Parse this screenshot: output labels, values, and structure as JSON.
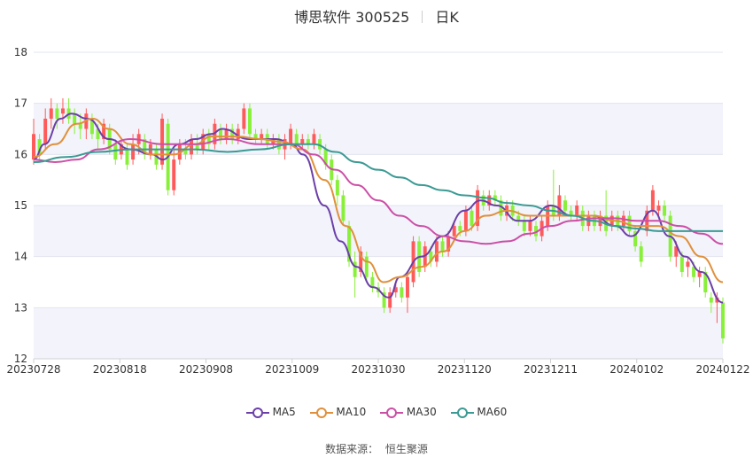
{
  "title": {
    "name": "博思软件 300525",
    "period": "日K"
  },
  "source": {
    "label": "数据来源：",
    "value": "恒生聚源"
  },
  "colors": {
    "up": "#ff5a5a",
    "down": "#89f03a",
    "ma5": "#6b3fa8",
    "ma10": "#e0903c",
    "ma30": "#cc4fa6",
    "ma60": "#3b9a93",
    "band": "#f2f3fb"
  },
  "chart_data": {
    "type": "candlestick",
    "ylim": [
      12,
      18
    ],
    "yticks": [
      "12",
      "13",
      "14",
      "15",
      "16",
      "17",
      "18"
    ],
    "xticks": [
      "20230728",
      "20230818",
      "20230908",
      "20231009",
      "20231030",
      "20231120",
      "20231211",
      "20240102",
      "20240122"
    ],
    "n_days": 120,
    "candles": [
      {
        "o": 15.9,
        "c": 16.4,
        "h": 16.7,
        "l": 15.8
      },
      {
        "o": 16.3,
        "c": 16.0,
        "h": 16.4,
        "l": 15.9
      },
      {
        "o": 16.2,
        "c": 16.7,
        "h": 16.9,
        "l": 16.1
      },
      {
        "o": 16.7,
        "c": 16.9,
        "h": 17.1,
        "l": 16.5
      },
      {
        "o": 16.9,
        "c": 16.7,
        "h": 17.0,
        "l": 16.5
      },
      {
        "o": 16.8,
        "c": 16.9,
        "h": 17.1,
        "l": 16.6
      },
      {
        "o": 16.9,
        "c": 16.7,
        "h": 17.1,
        "l": 16.6
      },
      {
        "o": 16.8,
        "c": 16.6,
        "h": 16.9,
        "l": 16.4
      },
      {
        "o": 16.6,
        "c": 16.5,
        "h": 16.8,
        "l": 16.3
      },
      {
        "o": 16.5,
        "c": 16.8,
        "h": 16.9,
        "l": 16.3
      },
      {
        "o": 16.7,
        "c": 16.4,
        "h": 16.8,
        "l": 16.3
      },
      {
        "o": 16.5,
        "c": 16.3,
        "h": 16.6,
        "l": 16.1
      },
      {
        "o": 16.3,
        "c": 16.6,
        "h": 16.7,
        "l": 16.2
      },
      {
        "o": 16.5,
        "c": 16.1,
        "h": 16.6,
        "l": 16.0
      },
      {
        "o": 16.2,
        "c": 15.9,
        "h": 16.3,
        "l": 15.8
      },
      {
        "o": 16.0,
        "c": 16.2,
        "h": 16.3,
        "l": 15.9
      },
      {
        "o": 16.1,
        "c": 15.8,
        "h": 16.2,
        "l": 15.7
      },
      {
        "o": 15.9,
        "c": 16.2,
        "h": 16.4,
        "l": 15.8
      },
      {
        "o": 16.2,
        "c": 16.4,
        "h": 16.5,
        "l": 16.0
      },
      {
        "o": 16.3,
        "c": 16.0,
        "h": 16.4,
        "l": 15.9
      },
      {
        "o": 16.0,
        "c": 16.2,
        "h": 16.3,
        "l": 15.9
      },
      {
        "o": 16.1,
        "c": 15.8,
        "h": 16.2,
        "l": 15.7
      },
      {
        "o": 15.8,
        "c": 16.7,
        "h": 16.8,
        "l": 15.7
      },
      {
        "o": 16.6,
        "c": 15.3,
        "h": 16.7,
        "l": 15.2
      },
      {
        "o": 15.3,
        "c": 15.9,
        "h": 16.1,
        "l": 15.2
      },
      {
        "o": 15.9,
        "c": 16.2,
        "h": 16.3,
        "l": 15.8
      },
      {
        "o": 16.1,
        "c": 16.0,
        "h": 16.3,
        "l": 15.9
      },
      {
        "o": 16.0,
        "c": 16.3,
        "h": 16.4,
        "l": 15.9
      },
      {
        "o": 16.2,
        "c": 16.1,
        "h": 16.4,
        "l": 16.0
      },
      {
        "o": 16.1,
        "c": 16.4,
        "h": 16.5,
        "l": 16.0
      },
      {
        "o": 16.4,
        "c": 16.2,
        "h": 16.5,
        "l": 16.1
      },
      {
        "o": 16.2,
        "c": 16.6,
        "h": 16.7,
        "l": 16.1
      },
      {
        "o": 16.5,
        "c": 16.3,
        "h": 16.6,
        "l": 16.2
      },
      {
        "o": 16.3,
        "c": 16.5,
        "h": 16.6,
        "l": 16.2
      },
      {
        "o": 16.5,
        "c": 16.3,
        "h": 16.6,
        "l": 16.2
      },
      {
        "o": 16.3,
        "c": 16.5,
        "h": 16.6,
        "l": 16.2
      },
      {
        "o": 16.5,
        "c": 16.9,
        "h": 17.0,
        "l": 16.4
      },
      {
        "o": 16.9,
        "c": 16.4,
        "h": 17.0,
        "l": 16.3
      },
      {
        "o": 16.4,
        "c": 16.3,
        "h": 16.5,
        "l": 16.2
      },
      {
        "o": 16.3,
        "c": 16.4,
        "h": 16.5,
        "l": 16.2
      },
      {
        "o": 16.4,
        "c": 16.2,
        "h": 16.5,
        "l": 16.1
      },
      {
        "o": 16.2,
        "c": 16.3,
        "h": 16.4,
        "l": 16.1
      },
      {
        "o": 16.3,
        "c": 16.1,
        "h": 16.4,
        "l": 16.0
      },
      {
        "o": 16.1,
        "c": 16.3,
        "h": 16.4,
        "l": 15.9
      },
      {
        "o": 16.2,
        "c": 16.5,
        "h": 16.6,
        "l": 16.1
      },
      {
        "o": 16.4,
        "c": 16.2,
        "h": 16.5,
        "l": 16.1
      },
      {
        "o": 16.2,
        "c": 16.3,
        "h": 16.4,
        "l": 16.1
      },
      {
        "o": 16.3,
        "c": 16.2,
        "h": 16.4,
        "l": 16.1
      },
      {
        "o": 16.2,
        "c": 16.4,
        "h": 16.5,
        "l": 16.1
      },
      {
        "o": 16.3,
        "c": 16.1,
        "h": 16.4,
        "l": 16.0
      },
      {
        "o": 16.1,
        "c": 15.8,
        "h": 16.2,
        "l": 15.7
      },
      {
        "o": 15.9,
        "c": 15.5,
        "h": 16.0,
        "l": 15.4
      },
      {
        "o": 15.5,
        "c": 15.2,
        "h": 15.6,
        "l": 15.0
      },
      {
        "o": 15.2,
        "c": 14.7,
        "h": 15.3,
        "l": 14.6
      },
      {
        "o": 14.6,
        "c": 13.9,
        "h": 14.7,
        "l": 13.8
      },
      {
        "o": 13.9,
        "c": 13.6,
        "h": 14.1,
        "l": 13.2
      },
      {
        "o": 13.7,
        "c": 14.1,
        "h": 14.2,
        "l": 13.6
      },
      {
        "o": 14.0,
        "c": 13.6,
        "h": 14.1,
        "l": 13.5
      },
      {
        "o": 13.6,
        "c": 13.4,
        "h": 13.7,
        "l": 13.3
      },
      {
        "o": 13.4,
        "c": 13.3,
        "h": 13.5,
        "l": 13.2
      },
      {
        "o": 13.3,
        "c": 13.0,
        "h": 13.4,
        "l": 12.9
      },
      {
        "o": 13.0,
        "c": 13.3,
        "h": 13.4,
        "l": 12.9
      },
      {
        "o": 13.3,
        "c": 13.4,
        "h": 13.5,
        "l": 13.2
      },
      {
        "o": 13.4,
        "c": 13.2,
        "h": 13.5,
        "l": 13.1
      },
      {
        "o": 13.2,
        "c": 13.6,
        "h": 13.7,
        "l": 12.9
      },
      {
        "o": 13.5,
        "c": 14.3,
        "h": 14.4,
        "l": 13.4
      },
      {
        "o": 14.3,
        "c": 13.7,
        "h": 14.4,
        "l": 13.6
      },
      {
        "o": 13.8,
        "c": 14.2,
        "h": 14.3,
        "l": 13.7
      },
      {
        "o": 14.1,
        "c": 13.9,
        "h": 14.2,
        "l": 13.8
      },
      {
        "o": 13.9,
        "c": 14.3,
        "h": 14.4,
        "l": 13.8
      },
      {
        "o": 14.3,
        "c": 14.1,
        "h": 14.4,
        "l": 14.0
      },
      {
        "o": 14.1,
        "c": 14.4,
        "h": 14.5,
        "l": 14.0
      },
      {
        "o": 14.4,
        "c": 14.6,
        "h": 14.7,
        "l": 14.3
      },
      {
        "o": 14.6,
        "c": 14.5,
        "h": 14.7,
        "l": 14.4
      },
      {
        "o": 14.5,
        "c": 14.9,
        "h": 15.0,
        "l": 14.4
      },
      {
        "o": 14.9,
        "c": 14.6,
        "h": 15.0,
        "l": 14.5
      },
      {
        "o": 14.6,
        "c": 15.3,
        "h": 15.4,
        "l": 14.5
      },
      {
        "o": 15.2,
        "c": 15.0,
        "h": 15.3,
        "l": 14.9
      },
      {
        "o": 15.0,
        "c": 15.2,
        "h": 15.3,
        "l": 14.9
      },
      {
        "o": 15.2,
        "c": 15.1,
        "h": 15.3,
        "l": 15.0
      },
      {
        "o": 15.1,
        "c": 14.8,
        "h": 15.2,
        "l": 14.7
      },
      {
        "o": 14.8,
        "c": 15.0,
        "h": 15.1,
        "l": 14.7
      },
      {
        "o": 15.0,
        "c": 14.8,
        "h": 15.1,
        "l": 14.7
      },
      {
        "o": 14.8,
        "c": 14.7,
        "h": 14.9,
        "l": 14.6
      },
      {
        "o": 14.7,
        "c": 14.5,
        "h": 14.8,
        "l": 14.4
      },
      {
        "o": 14.5,
        "c": 14.7,
        "h": 14.8,
        "l": 14.4
      },
      {
        "o": 14.6,
        "c": 14.4,
        "h": 14.7,
        "l": 14.3
      },
      {
        "o": 14.4,
        "c": 14.7,
        "h": 14.8,
        "l": 14.3
      },
      {
        "o": 14.6,
        "c": 15.0,
        "h": 15.1,
        "l": 14.5
      },
      {
        "o": 15.0,
        "c": 14.8,
        "h": 15.7,
        "l": 14.7
      },
      {
        "o": 14.8,
        "c": 15.2,
        "h": 15.4,
        "l": 14.7
      },
      {
        "o": 15.1,
        "c": 14.9,
        "h": 15.2,
        "l": 14.8
      },
      {
        "o": 14.9,
        "c": 14.8,
        "h": 15.0,
        "l": 14.7
      },
      {
        "o": 14.8,
        "c": 15.0,
        "h": 15.1,
        "l": 14.7
      },
      {
        "o": 14.9,
        "c": 14.6,
        "h": 15.0,
        "l": 14.5
      },
      {
        "o": 14.6,
        "c": 14.8,
        "h": 14.9,
        "l": 14.5
      },
      {
        "o": 14.8,
        "c": 14.6,
        "h": 14.9,
        "l": 14.5
      },
      {
        "o": 14.6,
        "c": 14.8,
        "h": 14.9,
        "l": 14.5
      },
      {
        "o": 14.8,
        "c": 14.5,
        "h": 15.3,
        "l": 14.4
      },
      {
        "o": 14.6,
        "c": 14.8,
        "h": 14.9,
        "l": 14.5
      },
      {
        "o": 14.8,
        "c": 14.6,
        "h": 14.9,
        "l": 14.5
      },
      {
        "o": 14.6,
        "c": 14.8,
        "h": 14.9,
        "l": 14.5
      },
      {
        "o": 14.8,
        "c": 14.5,
        "h": 14.9,
        "l": 14.4
      },
      {
        "o": 14.5,
        "c": 14.2,
        "h": 14.6,
        "l": 14.1
      },
      {
        "o": 14.2,
        "c": 13.9,
        "h": 14.3,
        "l": 13.8
      },
      {
        "o": 14.5,
        "c": 14.9,
        "h": 15.0,
        "l": 14.4
      },
      {
        "o": 14.9,
        "c": 15.3,
        "h": 15.4,
        "l": 14.8
      },
      {
        "o": 14.9,
        "c": 15.0,
        "h": 15.1,
        "l": 14.8
      },
      {
        "o": 15.0,
        "c": 14.8,
        "h": 15.1,
        "l": 14.7
      },
      {
        "o": 14.8,
        "c": 14.0,
        "h": 14.9,
        "l": 13.9
      },
      {
        "o": 14.0,
        "c": 14.2,
        "h": 14.3,
        "l": 13.8
      },
      {
        "o": 14.0,
        "c": 13.7,
        "h": 14.1,
        "l": 13.6
      },
      {
        "o": 13.8,
        "c": 13.9,
        "h": 14.0,
        "l": 13.6
      },
      {
        "o": 13.8,
        "c": 13.6,
        "h": 13.9,
        "l": 13.5
      },
      {
        "o": 13.6,
        "c": 13.7,
        "h": 13.8,
        "l": 13.4
      },
      {
        "o": 13.7,
        "c": 13.3,
        "h": 13.8,
        "l": 13.2
      },
      {
        "o": 13.2,
        "c": 13.1,
        "h": 13.3,
        "l": 12.9
      },
      {
        "o": 13.1,
        "c": 13.2,
        "h": 13.3,
        "l": 12.7
      },
      {
        "o": 13.1,
        "c": 12.4,
        "h": 13.2,
        "l": 12.3
      }
    ],
    "series": [
      {
        "name": "MA5",
        "points": [
          [
            0,
            15.9
          ],
          [
            2,
            16.2
          ],
          [
            5,
            16.7
          ],
          [
            7,
            16.8
          ],
          [
            10,
            16.7
          ],
          [
            14,
            16.3
          ],
          [
            18,
            16.1
          ],
          [
            22,
            16.0
          ],
          [
            24,
            15.9
          ],
          [
            27,
            16.2
          ],
          [
            30,
            16.3
          ],
          [
            33,
            16.4
          ],
          [
            35,
            16.5
          ],
          [
            40,
            16.3
          ],
          [
            45,
            16.3
          ],
          [
            48,
            16.2
          ],
          [
            50,
            16.0
          ],
          [
            54,
            15.0
          ],
          [
            57,
            14.3
          ],
          [
            60,
            13.8
          ],
          [
            63,
            13.4
          ],
          [
            66,
            13.2
          ],
          [
            68,
            13.6
          ],
          [
            72,
            14.0
          ],
          [
            76,
            14.4
          ],
          [
            80,
            14.9
          ],
          [
            83,
            15.1
          ],
          [
            86,
            15.0
          ],
          [
            90,
            14.7
          ],
          [
            92,
            14.7
          ],
          [
            96,
            15.0
          ],
          [
            100,
            14.8
          ],
          [
            104,
            14.8
          ],
          [
            108,
            14.6
          ],
          [
            111,
            14.4
          ],
          [
            115,
            14.9
          ],
          [
            118,
            14.4
          ],
          [
            121,
            14.0
          ],
          [
            124,
            13.7
          ],
          [
            128,
            13.1
          ]
        ]
      },
      {
        "name": "MA10",
        "points": [
          [
            0,
            15.95
          ],
          [
            4,
            16.2
          ],
          [
            8,
            16.6
          ],
          [
            11,
            16.7
          ],
          [
            14,
            16.5
          ],
          [
            18,
            16.2
          ],
          [
            22,
            16.0
          ],
          [
            26,
            16.0
          ],
          [
            30,
            16.2
          ],
          [
            33,
            16.35
          ],
          [
            38,
            16.35
          ],
          [
            42,
            16.3
          ],
          [
            46,
            16.25
          ],
          [
            50,
            16.1
          ],
          [
            54,
            15.5
          ],
          [
            58,
            14.6
          ],
          [
            62,
            13.9
          ],
          [
            65,
            13.5
          ],
          [
            68,
            13.6
          ],
          [
            72,
            13.8
          ],
          [
            76,
            14.1
          ],
          [
            80,
            14.5
          ],
          [
            84,
            14.8
          ],
          [
            88,
            14.9
          ],
          [
            92,
            14.8
          ],
          [
            96,
            14.8
          ],
          [
            100,
            14.8
          ],
          [
            104,
            14.8
          ],
          [
            108,
            14.7
          ],
          [
            112,
            14.6
          ],
          [
            116,
            14.6
          ],
          [
            120,
            14.4
          ],
          [
            124,
            14.0
          ],
          [
            128,
            13.5
          ]
        ]
      },
      {
        "name": "MA30",
        "points": [
          [
            0,
            15.9
          ],
          [
            4,
            15.85
          ],
          [
            8,
            15.9
          ],
          [
            12,
            16.1
          ],
          [
            18,
            16.3
          ],
          [
            24,
            16.2
          ],
          [
            30,
            16.2
          ],
          [
            36,
            16.3
          ],
          [
            42,
            16.2
          ],
          [
            48,
            16.2
          ],
          [
            52,
            16.0
          ],
          [
            56,
            15.7
          ],
          [
            60,
            15.4
          ],
          [
            64,
            15.1
          ],
          [
            68,
            14.8
          ],
          [
            72,
            14.6
          ],
          [
            76,
            14.4
          ],
          [
            80,
            14.3
          ],
          [
            84,
            14.25
          ],
          [
            88,
            14.3
          ],
          [
            92,
            14.45
          ],
          [
            96,
            14.6
          ],
          [
            100,
            14.7
          ],
          [
            104,
            14.75
          ],
          [
            108,
            14.75
          ],
          [
            112,
            14.7
          ],
          [
            116,
            14.7
          ],
          [
            120,
            14.6
          ],
          [
            124,
            14.45
          ],
          [
            128,
            14.25
          ]
        ]
      },
      {
        "name": "MA60",
        "points": [
          [
            0,
            15.85
          ],
          [
            6,
            15.95
          ],
          [
            12,
            16.05
          ],
          [
            18,
            16.1
          ],
          [
            24,
            16.1
          ],
          [
            30,
            16.1
          ],
          [
            36,
            16.05
          ],
          [
            42,
            16.1
          ],
          [
            48,
            16.2
          ],
          [
            52,
            16.2
          ],
          [
            56,
            16.05
          ],
          [
            60,
            15.85
          ],
          [
            64,
            15.7
          ],
          [
            68,
            15.55
          ],
          [
            72,
            15.4
          ],
          [
            76,
            15.3
          ],
          [
            80,
            15.2
          ],
          [
            84,
            15.15
          ],
          [
            88,
            15.05
          ],
          [
            92,
            15.0
          ],
          [
            96,
            14.9
          ],
          [
            100,
            14.8
          ],
          [
            104,
            14.7
          ],
          [
            108,
            14.6
          ],
          [
            112,
            14.55
          ],
          [
            116,
            14.5
          ],
          [
            120,
            14.5
          ],
          [
            124,
            14.5
          ],
          [
            128,
            14.5
          ]
        ]
      }
    ]
  }
}
